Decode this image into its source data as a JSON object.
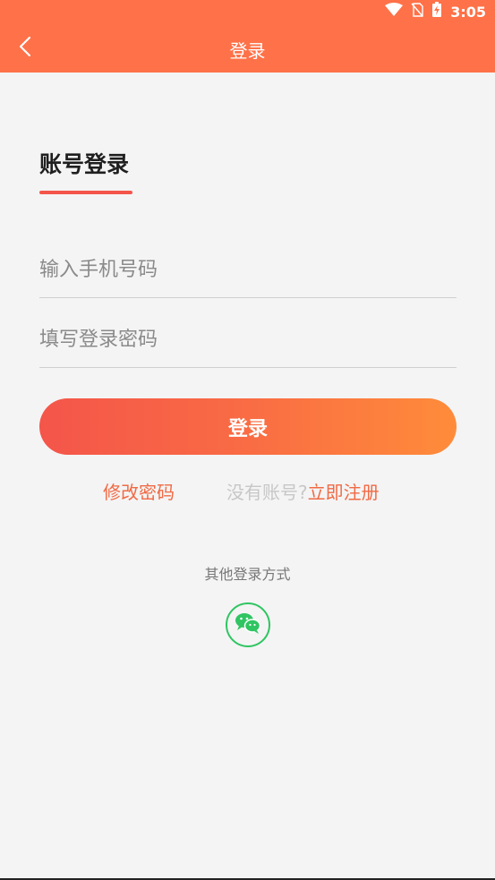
{
  "status_bar": {
    "time": "3:05",
    "icons": [
      "wifi-icon",
      "no-sim-icon",
      "battery-charging-icon"
    ]
  },
  "nav": {
    "title": "登录",
    "back_icon": "back-arrow-icon"
  },
  "login_tab": {
    "title": "账号登录"
  },
  "form": {
    "phone_placeholder": "输入手机号码",
    "phone_value": "",
    "password_placeholder": "填写登录密码",
    "password_value": "",
    "submit_label": "登录"
  },
  "links": {
    "change_password": "修改密码",
    "no_account": "没有账号?",
    "register": "立即注册"
  },
  "other_login": {
    "label": "其他登录方式",
    "wechat_icon": "wechat-icon"
  },
  "colors": {
    "accent": "#ff7148",
    "button_gradient_start": "#f4554a",
    "button_gradient_end": "#ff8c3a",
    "link": "#f06a45",
    "wechat_green": "#2fc562"
  }
}
